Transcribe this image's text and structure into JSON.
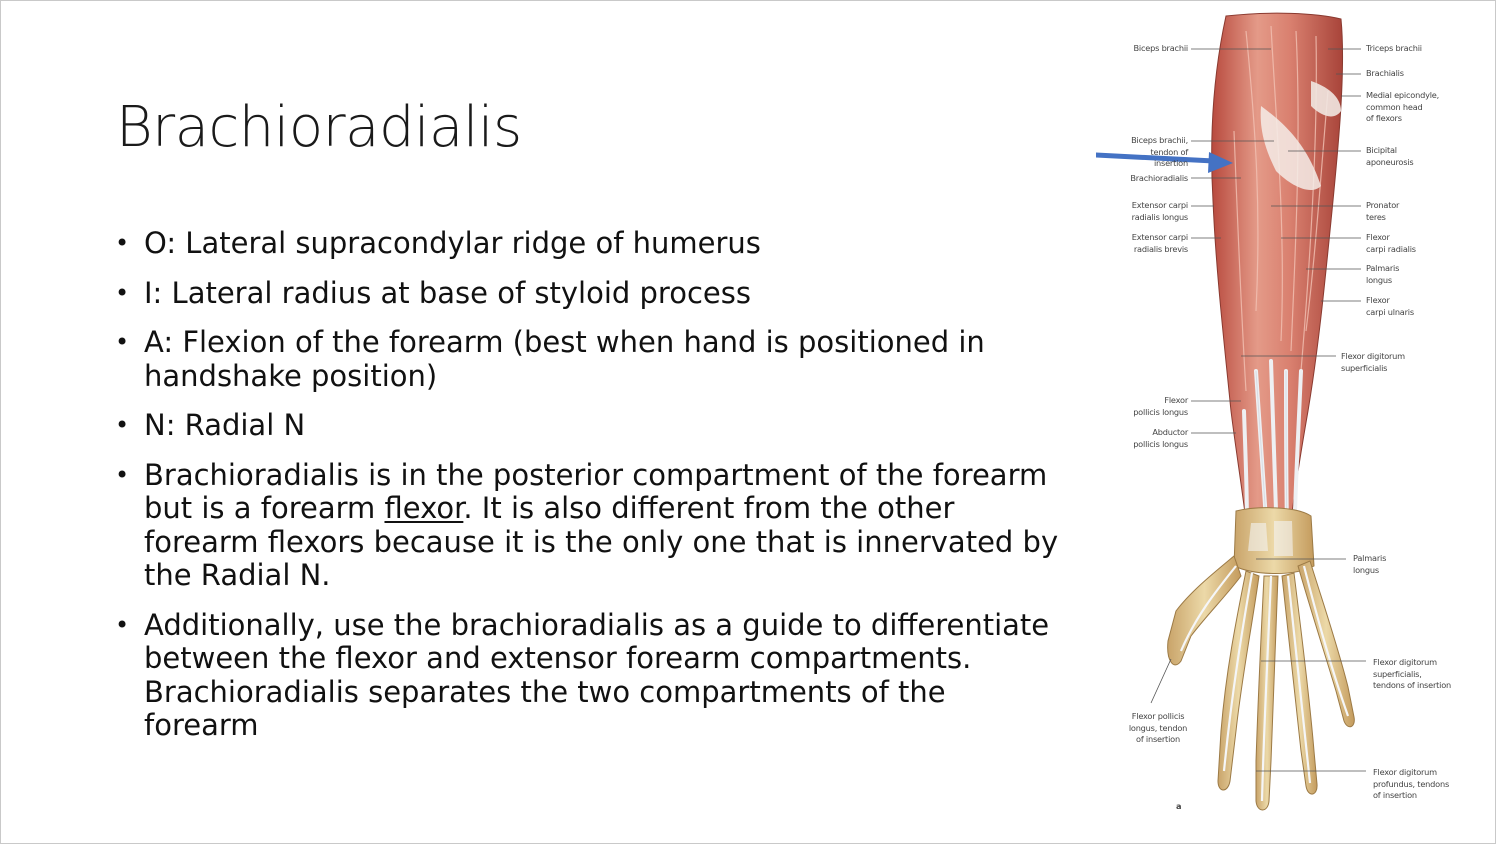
{
  "slide": {
    "title": "Brachioradialis",
    "bullets": [
      {
        "text": "O: Lateral supracondylar ridge of humerus"
      },
      {
        "text": "I: Lateral radius at base of styloid process"
      },
      {
        "text": "A: Flexion of the forearm (best when hand is positioned in handshake position)"
      },
      {
        "text": "N: Radial N"
      },
      {
        "before": "Brachioradialis is in the posterior compartment of the forearm but is a forearm ",
        "underlined": "flexor",
        "after": ". It is also different from the other forearm flexors because it is the only one that is innervated by the Radial N."
      },
      {
        "text": "Additionally, use the brachioradialis as a guide to differentiate between the flexor and extensor forearm compartments. Brachioradialis separates the two compartments of the forearm"
      }
    ]
  },
  "figure": {
    "arrow_color": "#4472c4",
    "panel_letter": "a",
    "labels_left": [
      "Biceps brachii",
      "Biceps brachii,\ntendon of\ninsertion",
      "Brachioradialis",
      "Extensor carpi\nradialis longus",
      "Extensor carpi\nradialis brevis",
      "Flexor\npollicis longus",
      "Abductor\npollicis longus",
      "Flexor pollicis\nlongus, tendon\nof insertion"
    ],
    "labels_right": [
      "Triceps brachii",
      "Brachialis",
      "Medial epicondyle,\ncommon head\nof flexors",
      "Bicipital\naponeurosis",
      "Pronator\nteres",
      "Flexor\ncarpi radialis",
      "Palmaris\nlongus",
      "Flexor\ncarpi ulnaris",
      "Flexor digitorum\nsuperficialis",
      "Palmaris\nlongus",
      "Flexor digitorum\nsuperficialis,\ntendons of insertion",
      "Flexor digitorum\nprofundus, tendons\nof insertion"
    ]
  }
}
